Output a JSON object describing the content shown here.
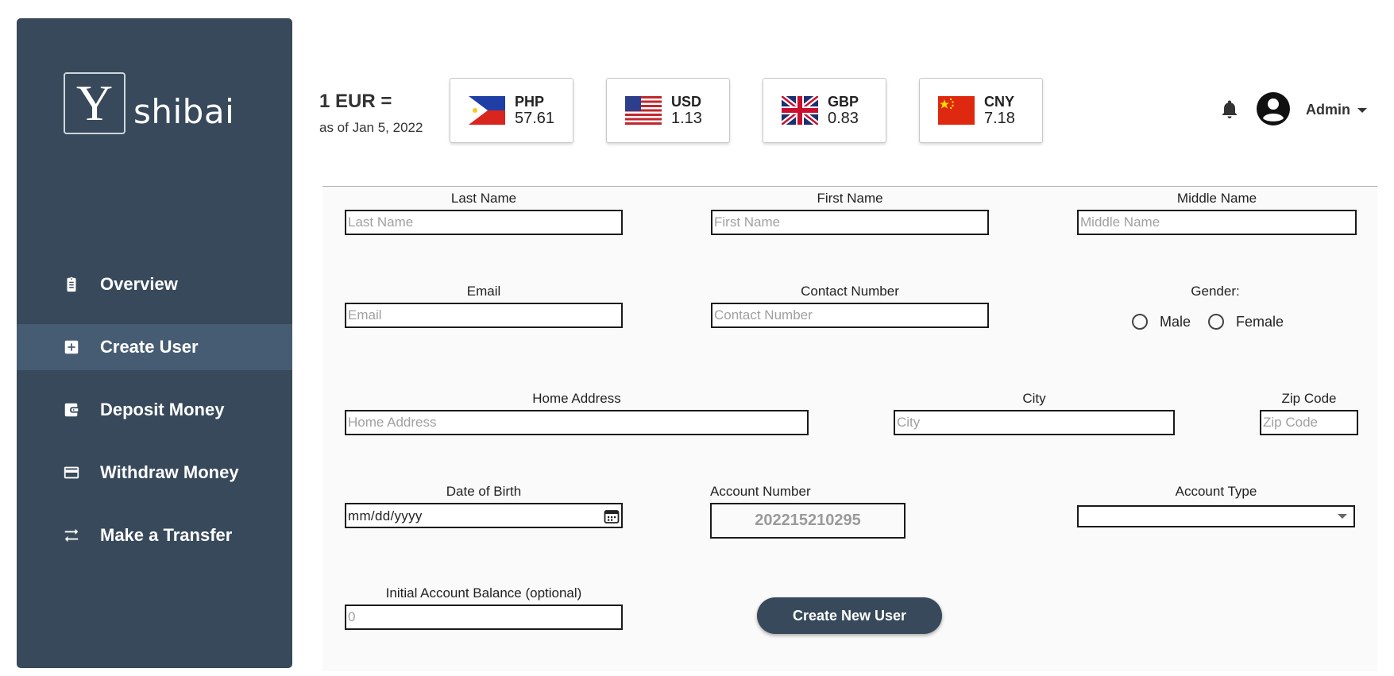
{
  "app": {
    "brand_letter": "Y",
    "brand_name": "shibai"
  },
  "sidebar": {
    "items": [
      {
        "label": "Overview",
        "icon": "clipboard-icon",
        "active": false
      },
      {
        "label": "Create User",
        "icon": "plus-square-icon",
        "active": true
      },
      {
        "label": "Deposit Money",
        "icon": "wallet-icon",
        "active": false
      },
      {
        "label": "Withdraw Money",
        "icon": "credit-card-icon",
        "active": false
      },
      {
        "label": "Make a Transfer",
        "icon": "transfer-arrows-icon",
        "active": false
      }
    ]
  },
  "header": {
    "rate_title": "1 EUR =",
    "rate_date": "as of Jan 5, 2022",
    "rates": [
      {
        "code": "PHP",
        "value": "57.61",
        "flag": "philippines-flag"
      },
      {
        "code": "USD",
        "value": "1.13",
        "flag": "us-flag"
      },
      {
        "code": "GBP",
        "value": "0.83",
        "flag": "uk-flag"
      },
      {
        "code": "CNY",
        "value": "7.18",
        "flag": "china-flag"
      }
    ],
    "user_label": "Admin"
  },
  "form": {
    "last_name": {
      "label": "Last Name",
      "placeholder": "Last Name"
    },
    "first_name": {
      "label": "First Name",
      "placeholder": "First Name"
    },
    "middle_name": {
      "label": "Middle Name",
      "placeholder": "Middle Name"
    },
    "email": {
      "label": "Email",
      "placeholder": "Email"
    },
    "contact": {
      "label": "Contact Number",
      "placeholder": "Contact Number"
    },
    "gender": {
      "label": "Gender:",
      "male": "Male",
      "female": "Female"
    },
    "address": {
      "label": "Home Address",
      "placeholder": "Home Address"
    },
    "city": {
      "label": "City",
      "placeholder": "City"
    },
    "zip": {
      "label": "Zip Code",
      "placeholder": "Zip Code"
    },
    "dob": {
      "label": "Date of Birth",
      "placeholder": "mm/dd/yyyy"
    },
    "account_number": {
      "label": "Account Number",
      "value": "202215210295"
    },
    "account_type": {
      "label": "Account Type",
      "value": ""
    },
    "initial_balance": {
      "label": "Initial Account Balance (optional)",
      "placeholder": "0"
    },
    "submit_label": "Create New User"
  },
  "colors": {
    "sidebar_bg": "#37495a",
    "sidebar_active": "#465c72",
    "button_bg": "#37495a"
  }
}
